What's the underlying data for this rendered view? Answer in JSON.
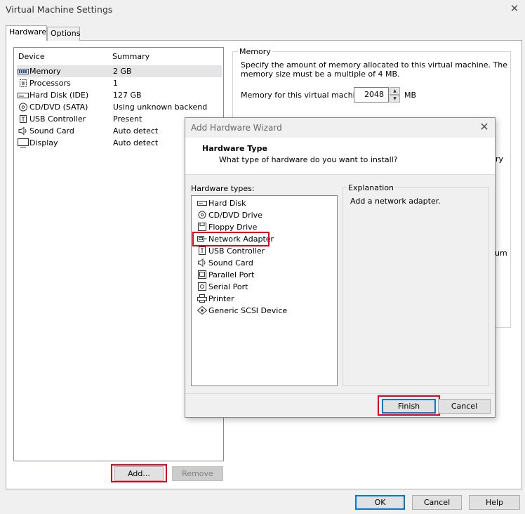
{
  "window": {
    "title": "Virtual Machine Settings",
    "close_glyph": "✕"
  },
  "tabs": [
    {
      "label": "Hardware"
    },
    {
      "label": "Options"
    }
  ],
  "device_list": {
    "headers": {
      "device": "Device",
      "summary": "Summary"
    },
    "rows": [
      {
        "name": "Memory",
        "summary": "2 GB",
        "icon": "memory-icon"
      },
      {
        "name": "Processors",
        "summary": "1",
        "icon": "processor-icon"
      },
      {
        "name": "Hard Disk (IDE)",
        "summary": "127 GB",
        "icon": "hard-disk-icon"
      },
      {
        "name": "CD/DVD (SATA)",
        "summary": "Using unknown backend",
        "icon": "cd-dvd-icon"
      },
      {
        "name": "USB Controller",
        "summary": "Present",
        "icon": "usb-icon"
      },
      {
        "name": "Sound Card",
        "summary": "Auto detect",
        "icon": "speaker-icon"
      },
      {
        "name": "Display",
        "summary": "Auto detect",
        "icon": "display-icon"
      }
    ]
  },
  "device_buttons": {
    "add": "Add...",
    "remove": "Remove"
  },
  "memory": {
    "legend": "Memory",
    "description": "Specify the amount of memory allocated to this virtual machine. The memory size must be a multiple of 4 MB.",
    "label": "Memory for this virtual machine:",
    "value": "2048",
    "unit": "MB"
  },
  "partial_text": {
    "ry": "ry",
    "um": "um"
  },
  "wizard": {
    "title": "Add Hardware Wizard",
    "close_glyph": "✕",
    "heading": "Hardware Type",
    "subheading": "What type of hardware do you want to install?",
    "types_label": "Hardware types:",
    "types": [
      {
        "label": "Hard Disk",
        "icon": "hard-disk-icon"
      },
      {
        "label": "CD/DVD Drive",
        "icon": "cd-dvd-icon"
      },
      {
        "label": "Floppy Drive",
        "icon": "floppy-icon"
      },
      {
        "label": "Network Adapter",
        "icon": "network-adapter-icon",
        "selected": true
      },
      {
        "label": "USB Controller",
        "icon": "usb-icon"
      },
      {
        "label": "Sound Card",
        "icon": "speaker-icon"
      },
      {
        "label": "Parallel Port",
        "icon": "parallel-port-icon"
      },
      {
        "label": "Serial Port",
        "icon": "serial-port-icon"
      },
      {
        "label": "Printer",
        "icon": "printer-icon"
      },
      {
        "label": "Generic SCSI Device",
        "icon": "scsi-icon"
      }
    ],
    "explanation_legend": "Explanation",
    "explanation_text": "Add a network adapter.",
    "finish": "Finish",
    "cancel": "Cancel"
  },
  "footer_buttons": {
    "ok": "OK",
    "cancel": "Cancel",
    "help": "Help"
  },
  "colors": {
    "highlight": "#e8001c",
    "accent": "#0078d7",
    "selected_row": "#e5e5e5"
  }
}
